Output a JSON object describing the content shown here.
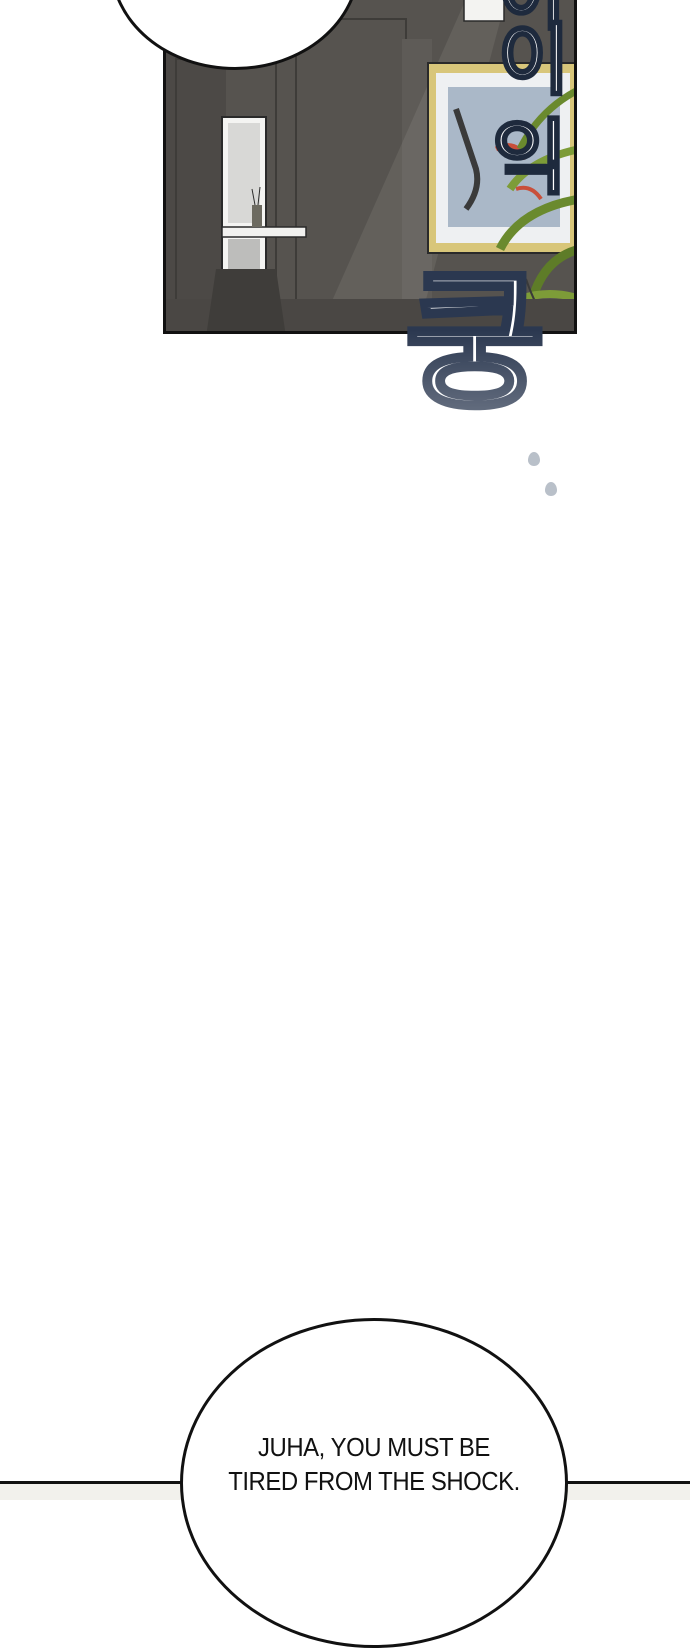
{
  "sfx": {
    "glyph_1": "이",
    "glyph_2": "익",
    "glyph_3": "쿵",
    "glyph_top": "이"
  },
  "dialogue": {
    "line_1": "JUHA, YOU MUST BE",
    "line_2": "TIRED FROM THE SHOCK."
  },
  "colors": {
    "panel_wall": "#55524e",
    "sfx_outline": "#1e2a3d",
    "plant": "#6a8a2e"
  }
}
